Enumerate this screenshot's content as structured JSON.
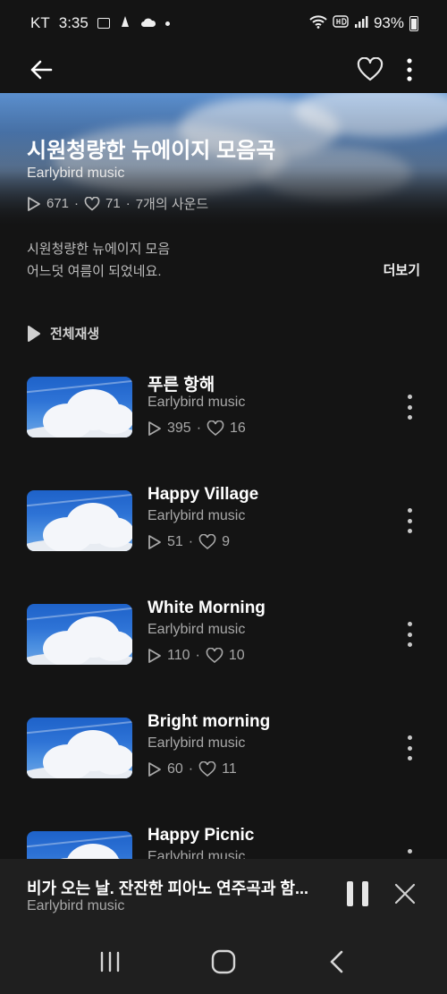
{
  "status_bar": {
    "carrier": "KT",
    "time": "3:35",
    "battery": "93%",
    "icons": [
      "image-icon",
      "app-icon",
      "cloud-icon",
      "dot-icon",
      "wifi-icon",
      "hd-icon",
      "signal-icon",
      "battery-icon"
    ]
  },
  "top_bar": {
    "icons": [
      "back-arrow-icon",
      "heart-icon",
      "more-vertical-icon"
    ]
  },
  "playlist": {
    "title": "시원청량한 뉴에이지 모음곡",
    "artist": "Earlybird music",
    "plays": "671",
    "likes": "71",
    "sound_count": "7개의 사운드",
    "description_line1": "시원청량한 뉴에이지 모음",
    "description_line2": "어느덧 여름이 되었네요.",
    "more_label": "더보기",
    "play_all_label": "전체재생"
  },
  "tracks": [
    {
      "title": "푸른 항해",
      "artist": "Earlybird music",
      "plays": "395",
      "likes": "16"
    },
    {
      "title": "Happy Village",
      "artist": "Earlybird music",
      "plays": "51",
      "likes": "9"
    },
    {
      "title": "White Morning",
      "artist": "Earlybird music",
      "plays": "110",
      "likes": "10"
    },
    {
      "title": "Bright morning",
      "artist": "Earlybird music",
      "plays": "60",
      "likes": "11"
    },
    {
      "title": "Happy Picnic",
      "artist": "Earlybird music",
      "plays": "",
      "likes": ""
    }
  ],
  "mini_player": {
    "title": "비가 오는 날. 잔잔한 피아노 연주곡과 함...",
    "artist": "Earlybird music",
    "icons": [
      "pause-icon",
      "close-icon"
    ]
  },
  "nav_bar": {
    "icons": [
      "recent-apps-icon",
      "home-icon",
      "back-icon"
    ]
  },
  "colors": {
    "background": "#141414",
    "panel": "#1f1f1f",
    "secondary_text": "#a8a8a8",
    "sky_blue": "#2e73d6"
  }
}
